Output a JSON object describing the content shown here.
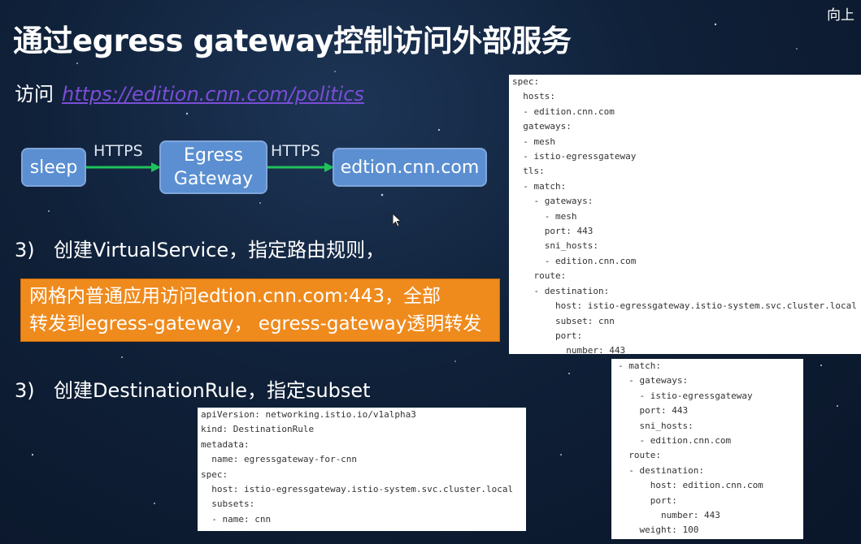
{
  "slide": {
    "title": "通过egress gateway控制访问外部服务",
    "corner_text": "向上"
  },
  "visit": {
    "prefix": "访问",
    "url": "https://edition.cnn.com/politics"
  },
  "flow": {
    "nodes": [
      "sleep",
      "Egress\nGateway",
      "edtion.cnn.com"
    ],
    "arrow_labels": [
      "HTTPS",
      "HTTPS"
    ]
  },
  "steps": [
    {
      "num": "3)",
      "text": "创建VirtualService，指定路由规则，"
    },
    {
      "num": "3)",
      "text": "创建DestinationRule，指定subset"
    }
  ],
  "callout": {
    "line1": "网格内普通应用访问edtion.cnn.com:443，全部",
    "line2": "转发到egress-gateway，  egress-gateway透明转发"
  },
  "code": {
    "virtual_service": "spec:\n  hosts:\n  - edition.cnn.com\n  gateways:\n  - mesh\n  - istio-egressgateway\n  tls:\n  - match:\n    - gateways:\n      - mesh\n      port: 443\n      sni_hosts:\n      - edition.cnn.com\n    route:\n    - destination:\n        host: istio-egressgateway.istio-system.svc.cluster.local\n        subset: cnn\n        port:\n          number: 443",
    "route_match": "- match:\n  - gateways:\n    - istio-egressgateway\n    port: 443\n    sni_hosts:\n    - edition.cnn.com\n  route:\n  - destination:\n      host: edition.cnn.com\n      port:\n        number: 443\n    weight: 100",
    "destination_rule": "apiVersion: networking.istio.io/v1alpha3\nkind: DestinationRule\nmetadata:\n  name: egressgateway-for-cnn\nspec:\n  host: istio-egressgateway.istio-system.svc.cluster.local\n  subsets:\n  - name: cnn"
  },
  "colors": {
    "background": "#0f2038",
    "node_fill": "#5b8fd1",
    "arrow": "#1fc25a",
    "callout": "#ef8a1c",
    "link": "#7b4dd6"
  }
}
